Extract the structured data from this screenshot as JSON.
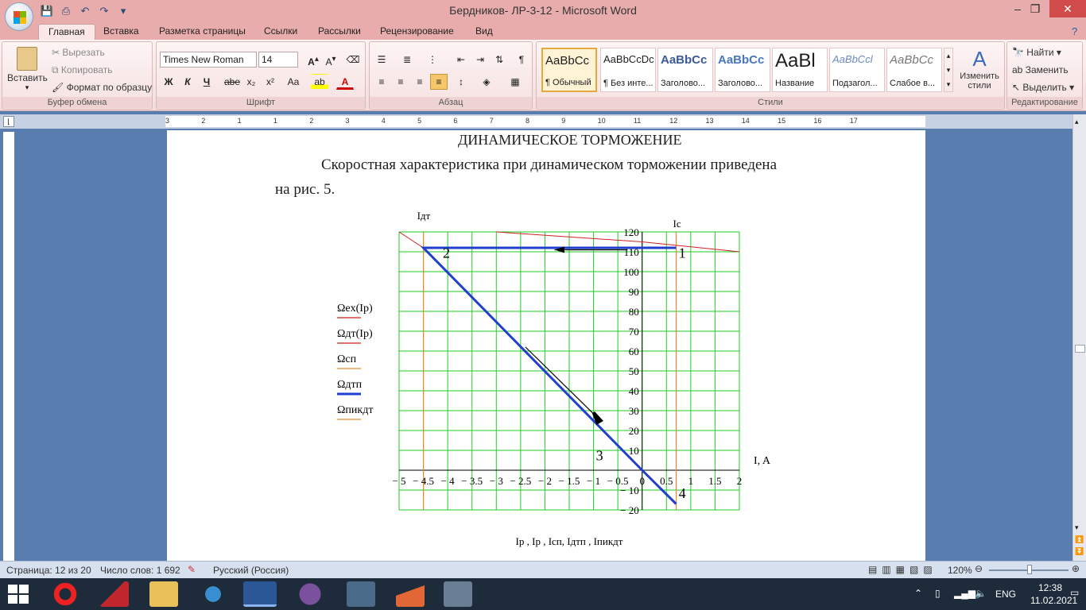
{
  "window": {
    "title": "Бердников- ЛР-3-12 - Microsoft Word"
  },
  "tabs": [
    {
      "label": "Главная",
      "active": true
    },
    {
      "label": "Вставка"
    },
    {
      "label": "Разметка страницы"
    },
    {
      "label": "Ссылки"
    },
    {
      "label": "Рассылки"
    },
    {
      "label": "Рецензирование"
    },
    {
      "label": "Вид"
    }
  ],
  "ribbon": {
    "clipboard": {
      "label": "Буфер обмена",
      "paste": "Вставить",
      "cut": "Вырезать",
      "copy": "Копировать",
      "format_painter": "Формат по образцу"
    },
    "font": {
      "label": "Шрифт",
      "family": "Times New Roman",
      "size": "14",
      "bold": "Ж",
      "italic": "К",
      "underline": "Ч",
      "strike": "abe",
      "sub": "x₂",
      "sup": "x²",
      "case": "Aa"
    },
    "paragraph": {
      "label": "Абзац"
    },
    "styles": {
      "label": "Стили",
      "items": [
        {
          "sample": "AaBbCc",
          "name": "¶ Обычный"
        },
        {
          "sample": "AaBbCcDc",
          "name": "¶ Без инте..."
        },
        {
          "sample": "AaBbCc",
          "name": "Заголово..."
        },
        {
          "sample": "AaBbCc",
          "name": "Заголово..."
        },
        {
          "sample": "AaBl",
          "name": "Название"
        },
        {
          "sample": "AaBbCcl",
          "name": "Подзагол..."
        },
        {
          "sample": "AaBbCc",
          "name": "Слабое в..."
        }
      ],
      "change": "Изменить стили"
    },
    "editing": {
      "label": "Редактирование",
      "find": "Найти",
      "replace": "Заменить",
      "select": "Выделить"
    }
  },
  "ruler": {
    "ticks": [
      "3",
      "2",
      "1",
      "1",
      "2",
      "3",
      "4",
      "5",
      "6",
      "7",
      "8",
      "9",
      "10",
      "11",
      "12",
      "13",
      "14",
      "15",
      "16",
      "17"
    ]
  },
  "document": {
    "heading": "ДИНАМИЧЕСКОЕ ТОРМОЖЕНИЕ",
    "para_line1": "Скоростная характеристика при динамическом торможении приведена",
    "para_line2": "на рис. 5."
  },
  "chart_data": {
    "type": "line",
    "xlabel": "I, A",
    "bottom_label": "Iр , Iр , Iсп, Iдтп , Iпикдт",
    "xlim": [
      -5,
      2
    ],
    "ylim": [
      -20,
      120
    ],
    "x_ticks": [
      -5,
      -4.5,
      -4,
      -3.5,
      -3,
      -2.5,
      -2,
      -1.5,
      -1,
      -0.5,
      0,
      0.5,
      1,
      1.5,
      2
    ],
    "y_ticks": [
      -20,
      -10,
      10,
      20,
      30,
      40,
      50,
      60,
      70,
      80,
      90,
      100,
      110,
      120
    ],
    "vline_labels": {
      "left": "Iдт",
      "right": "Iс"
    },
    "point_labels": [
      "1",
      "2",
      "3",
      "4"
    ],
    "series": [
      {
        "name": "Ωex(Iр)",
        "color": "#cc2222",
        "x": [
          -5,
          -4.5
        ],
        "y": [
          120,
          112
        ]
      },
      {
        "name": "Ωдт(Iр)",
        "color": "#cc2222",
        "x": [
          -3,
          0,
          2
        ],
        "y": [
          120,
          115,
          110
        ]
      },
      {
        "name": "Ωсп",
        "color": "#e68a2e",
        "x": [
          0.7
        ],
        "y": [
          0
        ]
      },
      {
        "name": "Ωдтп",
        "color": "#1f3fcc",
        "x": [
          0.7,
          -4.5,
          0,
          0.7
        ],
        "y": [
          112,
          112,
          0,
          -17
        ]
      },
      {
        "name": "Ωпикдт",
        "color": "#e68a2e",
        "x": [
          -4.5
        ],
        "y": [
          0
        ]
      }
    ],
    "vlines": [
      -4.5,
      0.7
    ],
    "grid": true,
    "grid_color": "#22cc22"
  },
  "status": {
    "page": "Страница: 12 из 20",
    "words": "Число слов: 1 692",
    "lang": "Русский (Россия)",
    "zoom": "120%"
  },
  "taskbar": {
    "lang": "ENG",
    "time": "12:38",
    "date": "11.02.2021"
  }
}
